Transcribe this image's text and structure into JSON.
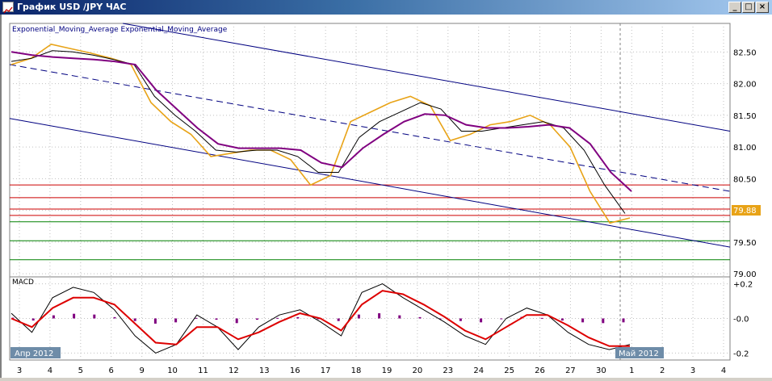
{
  "window": {
    "title": "График USD /JPY ЧАС",
    "minimize_label": "_",
    "restore_label": "□",
    "close_label": "×"
  },
  "indicator_legend": "Exponential_Moving_Average Exponential_Moving_Average",
  "macd_label": "MACD",
  "price_label": "79.88",
  "date_markers": {
    "start": "Апр 2012",
    "end": "Май 2012"
  },
  "colors": {
    "price": "#e8a317",
    "ema_slow": "#800080",
    "ema_fast": "#000000",
    "channel": "#000080",
    "resistance": "#cc0000",
    "support": "#008000",
    "macd_signal": "#dd0000",
    "histogram": "#800080",
    "grid": "#c0c0c0"
  },
  "chart_data": [
    {
      "type": "line",
      "title": "",
      "pair": "USD/JPY",
      "y_ticks": [
        "82.50",
        "82.00",
        "81.50",
        "81.00",
        "80.50",
        "80.00",
        "79.50",
        "79.00"
      ],
      "ylim": [
        78.95,
        82.95
      ],
      "x_ticks": [
        "3",
        "4",
        "5",
        "6",
        "9",
        "10",
        "11",
        "12",
        "13",
        "16",
        "17",
        "18",
        "19",
        "20",
        "23",
        "24",
        "25",
        "26",
        "27",
        "30",
        "1",
        "2",
        "3",
        "4"
      ],
      "resistance_levels": [
        80.4,
        80.2,
        80.02,
        79.92
      ],
      "support_levels": [
        79.82,
        79.52,
        79.22
      ],
      "series": [
        {
          "name": "price",
          "values": [
            82.3,
            82.4,
            82.62,
            82.55,
            82.48,
            82.4,
            82.3,
            81.7,
            81.4,
            81.2,
            80.85,
            80.9,
            80.95,
            80.95,
            80.8,
            80.4,
            80.55,
            81.4,
            81.55,
            81.7,
            81.8,
            81.65,
            81.1,
            81.2,
            81.35,
            81.4,
            81.5,
            81.35,
            81.0,
            80.3,
            79.8,
            79.88
          ]
        },
        {
          "name": "ema_slow",
          "values": [
            82.5,
            82.45,
            82.42,
            82.4,
            82.38,
            82.35,
            82.3,
            81.9,
            81.6,
            81.3,
            81.05,
            80.98,
            80.98,
            80.98,
            80.95,
            80.75,
            80.68,
            80.98,
            81.2,
            81.4,
            81.52,
            81.5,
            81.35,
            81.3,
            81.3,
            81.32,
            81.35,
            81.3,
            81.05,
            80.6,
            80.3
          ]
        },
        {
          "name": "ema_fast",
          "values": [
            82.35,
            82.4,
            82.52,
            82.5,
            82.45,
            82.38,
            82.3,
            81.8,
            81.5,
            81.25,
            80.95,
            80.92,
            80.95,
            80.95,
            80.85,
            80.6,
            80.6,
            81.15,
            81.4,
            81.55,
            81.7,
            81.6,
            81.25,
            81.25,
            81.3,
            81.35,
            81.4,
            81.3,
            80.95,
            80.4,
            79.95
          ]
        }
      ]
    },
    {
      "type": "line",
      "title": "MACD",
      "y_ticks": [
        "+0.2",
        "-0.0",
        "-0.2"
      ],
      "ylim": [
        -0.24,
        0.24
      ],
      "series": [
        {
          "name": "macd",
          "values": [
            0.03,
            -0.08,
            0.12,
            0.18,
            0.15,
            0.05,
            -0.1,
            -0.2,
            -0.15,
            0.02,
            -0.05,
            -0.18,
            -0.05,
            0.02,
            0.05,
            -0.02,
            -0.1,
            0.15,
            0.2,
            0.12,
            0.05,
            -0.02,
            -0.1,
            -0.15,
            0.0,
            0.06,
            0.02,
            -0.08,
            -0.15,
            -0.18,
            -0.15
          ]
        },
        {
          "name": "signal",
          "values": [
            0.0,
            -0.05,
            0.06,
            0.12,
            0.12,
            0.08,
            -0.03,
            -0.14,
            -0.15,
            -0.05,
            -0.05,
            -0.12,
            -0.08,
            -0.02,
            0.03,
            0.0,
            -0.07,
            0.08,
            0.16,
            0.14,
            0.08,
            0.01,
            -0.07,
            -0.12,
            -0.05,
            0.02,
            0.02,
            -0.04,
            -0.11,
            -0.16,
            -0.16
          ]
        }
      ]
    }
  ]
}
